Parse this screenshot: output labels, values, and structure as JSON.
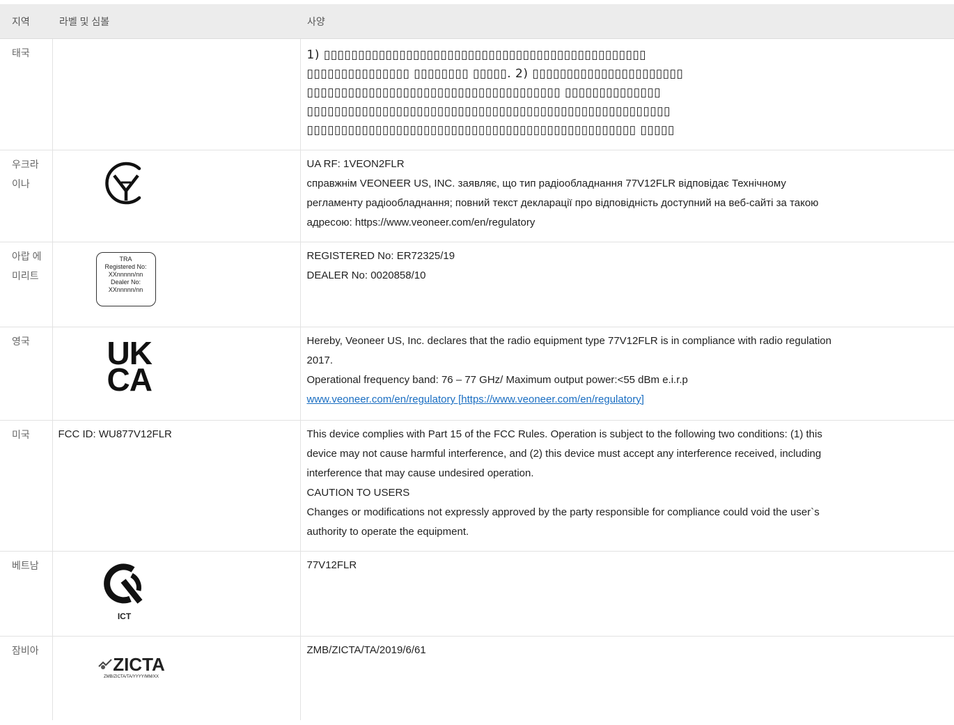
{
  "headers": {
    "region": "지역",
    "label": "라벨 및 심볼",
    "spec": "사양"
  },
  "rows": {
    "thailand": {
      "region": "태국",
      "spec_lines": [
        "1) ▯▯▯▯▯▯▯▯▯▯▯▯▯▯▯▯▯▯▯▯▯▯▯▯▯▯▯▯▯▯▯▯▯▯▯▯▯▯▯▯▯▯▯▯▯▯▯",
        "▯▯▯▯▯▯▯▯▯▯▯▯▯▯▯ ▯▯▯▯▯▯▯▯ ▯▯▯▯▯. 2) ▯▯▯▯▯▯▯▯▯▯▯▯▯▯▯▯▯▯▯▯▯▯",
        "▯▯▯▯▯▯▯▯▯▯▯▯▯▯▯▯▯▯▯▯▯▯▯▯▯▯▯▯▯▯▯▯▯▯▯▯▯ ▯▯▯▯▯▯▯▯▯▯▯▯▯▯",
        "▯▯▯▯▯▯▯▯▯▯▯▯▯▯▯▯▯▯▯▯▯▯▯▯▯▯▯▯▯▯▯▯▯▯▯▯▯▯▯▯▯▯▯▯▯▯▯▯▯▯▯▯▯",
        "▯▯▯▯▯▯▯▯▯▯▯▯▯▯▯▯▯▯▯▯▯▯▯▯▯▯▯▯▯▯▯▯▯▯▯▯▯▯▯▯▯▯▯▯▯▯▯▯ ▯▯▯▯▯"
      ]
    },
    "ukraine": {
      "region": "우크라이나",
      "spec_lines": [
        "UA RF: 1VEON2FLR",
        "справжнім VEONEER US, INC. заявляє, що тип радіообладнання 77V12FLR відповідає Технічному",
        "регламенту радіообладнання; повний текст декларації про відповідність доступний на веб-сайті за такою",
        "адресою: https://www.veoneer.com/en/regulatory"
      ]
    },
    "uae": {
      "region": "아랍 에미리트",
      "tra_logo": [
        "TRA",
        "Registered No:",
        "XXnnnnn/nn",
        "Dealer No:",
        "XXnnnnn/nn"
      ],
      "spec_lines": [
        "REGISTERED No: ER72325/19",
        "DEALER No: 0020858/10"
      ]
    },
    "uk": {
      "region": "영국",
      "logo_line1": "UK",
      "logo_line2": "CA",
      "spec_lines": [
        "Hereby, Veoneer US, Inc. declares that the radio equipment type 77V12FLR is in compliance with radio regulation",
        "2017.",
        "Operational frequency band: 76 – 77 GHz/ Maximum output power:<55 dBm e.i.r.p"
      ],
      "link_text": "www.veoneer.com/en/regulatory [https://www.veoneer.com/en/regulatory]"
    },
    "usa": {
      "region": "미국",
      "label": "FCC ID: WU877V12FLR",
      "spec_lines": [
        "This device complies with Part 15 of the FCC Rules. Operation is subject to the following two conditions: (1) this",
        "device may not cause harmful interference, and (2) this device must accept any interference received, including",
        "interference that may cause undesired operation.",
        "CAUTION TO USERS",
        "Changes or modifications not expressly approved by the party responsible for compliance could void the user`s",
        "authority to operate the equipment."
      ]
    },
    "vietnam": {
      "region": "베트남",
      "logo_text": "ICT",
      "spec_lines": [
        "77V12FLR"
      ]
    },
    "zambia": {
      "region": "잠비아",
      "logo_main": "ZICTA",
      "logo_sub": "ZMB/ZICTA/TA/YYYY/MM/XX",
      "spec_lines": [
        "ZMB/ZICTA/TA/2019/6/61"
      ]
    }
  }
}
